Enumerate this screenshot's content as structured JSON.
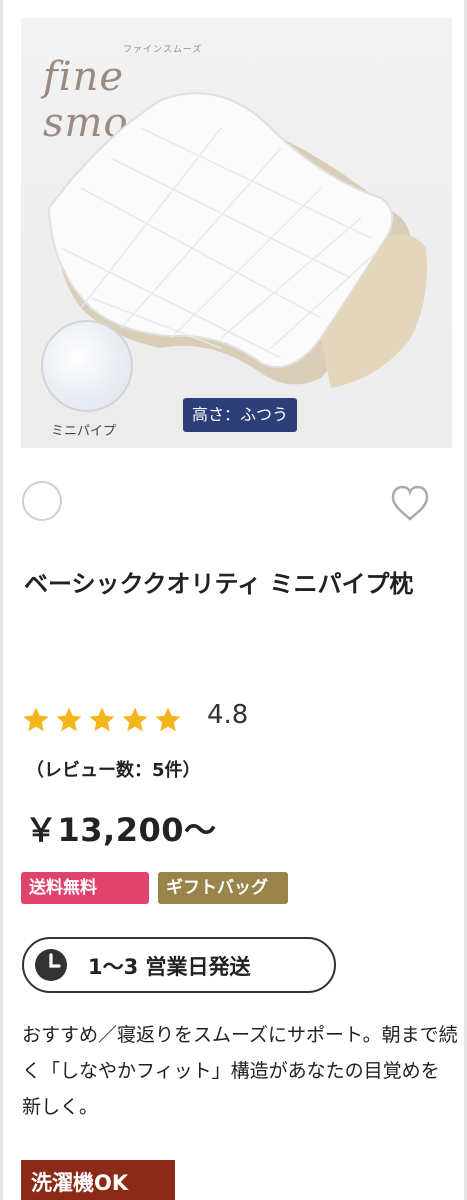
{
  "hero": {
    "brand_small": "ファインスムーズ",
    "brand": "fine smooth",
    "pipe_label": "ミニパイプ",
    "height_badge": "高さ：ふつう"
  },
  "product": {
    "title": "ベーシッククオリティ ミニパイプ枕",
    "rating": "4.8",
    "stars": 5,
    "reviews": "（レビュー数：5件）",
    "price": "￥13,200〜",
    "badges": [
      "送料無料",
      "ギフトバッグ"
    ],
    "shipping": "1〜3 営業日発送",
    "description": "おすすめ／寝返りをスムーズにサポート。朝まで続く「しなやかフィット」構造があなたの目覚めを新しく。",
    "wash_badge": "洗濯機OK"
  },
  "colors": {
    "star": "#f3b51a",
    "free_shipping": "#e0436c",
    "gift": "#9a844c",
    "height_badge": "#2c3f78",
    "wash": "#8c2a18"
  },
  "icons": [
    "radio-icon",
    "heart-icon",
    "star-icon",
    "clock-icon"
  ]
}
